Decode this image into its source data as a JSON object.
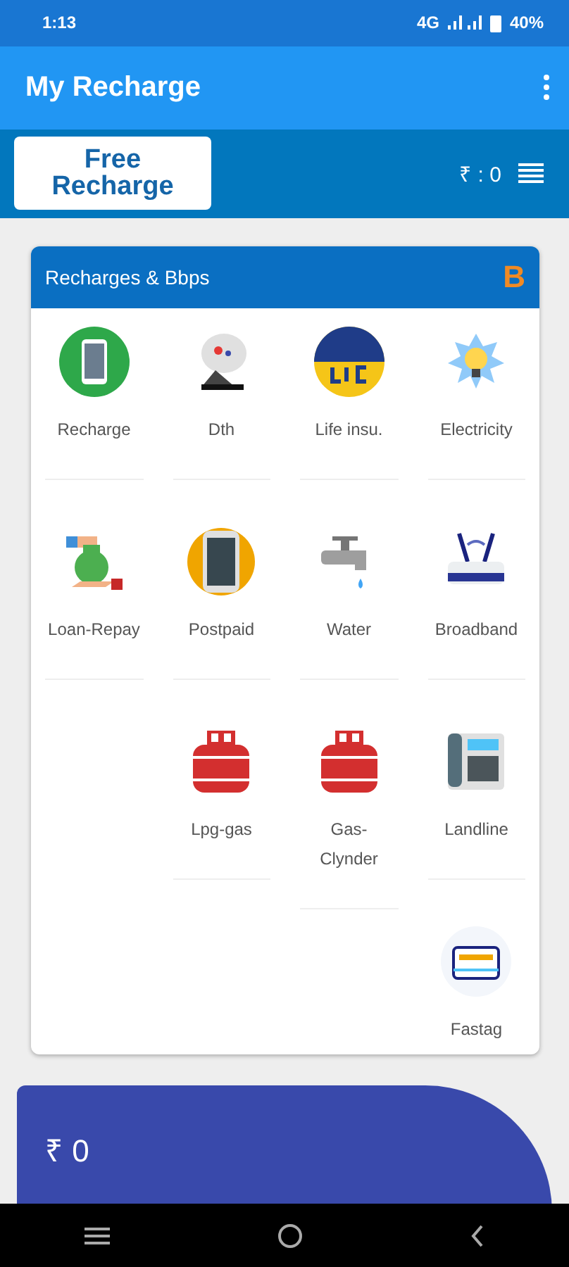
{
  "status_bar": {
    "time": "1:13",
    "network": "4G",
    "battery": "40%"
  },
  "app_bar": {
    "title": "My Recharge"
  },
  "banner": {
    "logo_lines": [
      "Free",
      "Recharge"
    ],
    "balance": "₹ : 0"
  },
  "services_card": {
    "title": "Recharges & Bbps",
    "badge": "B",
    "columns": [
      [
        {
          "label": "Recharge"
        },
        {
          "label": "Loan-Repay"
        }
      ],
      [
        {
          "label": "Dth"
        },
        {
          "label": "Postpaid"
        },
        {
          "label": "Lpg-gas"
        }
      ],
      [
        {
          "label": "Life insu."
        },
        {
          "label": "Water"
        },
        {
          "label": "Gas-Clynder"
        }
      ],
      [
        {
          "label": "Electricity"
        },
        {
          "label": "Broadband"
        },
        {
          "label": "Landline"
        },
        {
          "label": "Fastag"
        }
      ]
    ]
  },
  "wallet": {
    "amount": "₹ 0"
  }
}
